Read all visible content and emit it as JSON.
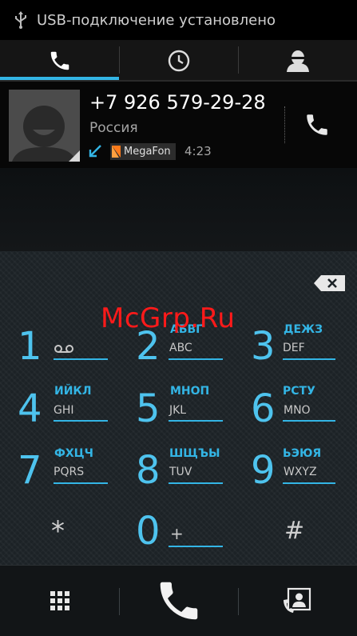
{
  "status_bar": {
    "text": "USB-подключение установлено"
  },
  "tabs": [
    {
      "name": "phone-tab",
      "icon": "phone-icon",
      "active": true
    },
    {
      "name": "recent-tab",
      "icon": "clock-icon",
      "active": false
    },
    {
      "name": "contacts-tab",
      "icon": "person-icon",
      "active": false
    }
  ],
  "call_log_entry": {
    "number": "+7 926 579-29-28",
    "location": "Россия",
    "carrier": "MegaFon",
    "duration": "4:23",
    "call_type_icon": "incoming-arrow-icon"
  },
  "dialpad": {
    "digits_value": "",
    "keys": [
      {
        "digit": "1",
        "cyr": "",
        "lat": ""
      },
      {
        "digit": "2",
        "cyr": "АБВГ",
        "lat": "ABC"
      },
      {
        "digit": "3",
        "cyr": "ДЕЖЗ",
        "lat": "DEF"
      },
      {
        "digit": "4",
        "cyr": "ИЙКЛ",
        "lat": "GHI"
      },
      {
        "digit": "5",
        "cyr": "МНОП",
        "lat": "JKL"
      },
      {
        "digit": "6",
        "cyr": "РСТУ",
        "lat": "MNO"
      },
      {
        "digit": "7",
        "cyr": "ФХЦЧ",
        "lat": "PQRS"
      },
      {
        "digit": "8",
        "cyr": "ШЩЪЫ",
        "lat": "TUV"
      },
      {
        "digit": "9",
        "cyr": "ЬЭЮЯ",
        "lat": "WXYZ"
      },
      {
        "digit": "*",
        "cyr": "",
        "lat": ""
      },
      {
        "digit": "0",
        "cyr": "",
        "lat": "+"
      },
      {
        "digit": "#",
        "cyr": "",
        "lat": ""
      }
    ]
  },
  "watermark": "McGrp.Ru",
  "colors": {
    "accent": "#33b5e5",
    "watermark": "#ff1a1a",
    "carrier_logo": "#ff7a1a"
  }
}
